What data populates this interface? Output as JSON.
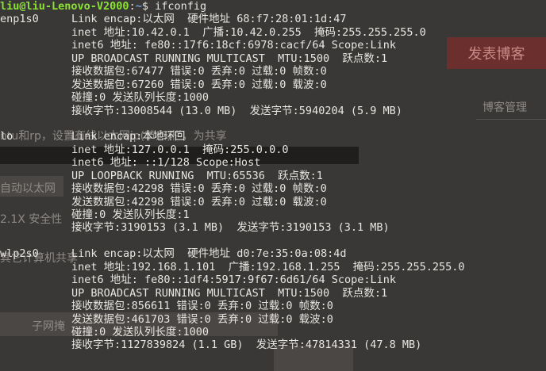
{
  "prompt": {
    "user_host": "liu@liu-Lenovo-V2000",
    "sep": ":",
    "path": "~",
    "symbol": "$ ",
    "command": "ifconfig"
  },
  "background": {
    "publish_button": "发表博客",
    "manage_link": "博客管理",
    "text_1": "ntu和rp，设置有线以太网ip(节点)栏，为共享",
    "text_2": "自动以太网",
    "text_3": "2.1X 安全性",
    "text_4": "其它计算机共享",
    "text_5": "子网掩"
  },
  "interfaces": [
    {
      "name": "enp1s0",
      "lines": [
        "Link encap:以太网  硬件地址 68:f7:28:01:1d:47",
        "inet 地址:10.42.0.1  广播:10.42.0.255  掩码:255.255.255.0",
        "inet6 地址: fe80::17f6:18cf:6978:cacf/64 Scope:Link",
        "UP BROADCAST RUNNING MULTICAST  MTU:1500  跃点数:1",
        "接收数据包:67477 错误:0 丢弃:0 过载:0 帧数:0",
        "发送数据包:67260 错误:0 丢弃:0 过载:0 载波:0",
        "碰撞:0 发送队列长度:1000",
        "接收字节:13008544 (13.0 MB)  发送字节:5940204 (5.9 MB)"
      ]
    },
    {
      "name": "lo",
      "lines": [
        "Link encap:本地环回",
        "inet 地址:127.0.0.1  掩码:255.0.0.0",
        "inet6 地址: ::1/128 Scope:Host",
        "UP LOOPBACK RUNNING  MTU:65536  跃点数:1",
        "接收数据包:42298 错误:0 丢弃:0 过载:0 帧数:0",
        "发送数据包:42298 错误:0 丢弃:0 过载:0 载波:0",
        "碰撞:0 发送队列长度:1",
        "接收字节:3190153 (3.1 MB)  发送字节:3190153 (3.1 MB)"
      ]
    },
    {
      "name": "wlp2s0",
      "lines": [
        "Link encap:以太网  硬件地址 d0:7e:35:0a:08:4d",
        "inet 地址:192.168.1.101  广播:192.168.1.255  掩码:255.255.255.0",
        "inet6 地址: fe80::1df4:5917:9f67:6d61/64 Scope:Link",
        "UP BROADCAST RUNNING MULTICAST  MTU:1500  跃点数:1",
        "接收数据包:856611 错误:0 丢弃:0 过载:0 帧数:0",
        "发送数据包:461703 错误:0 丢弃:0 过载:0 载波:0",
        "碰撞:0 发送队列长度:1000",
        "接收字节:1127839824 (1.1 GB)  发送字节:47814331 (47.8 MB)"
      ]
    }
  ],
  "colors": {
    "terminal_bg": "#2f2d2b",
    "prompt_user": "#8ae234",
    "prompt_path": "#729fcf",
    "text": "#e8e6e1",
    "publish_button_bg": "#6b2f2d"
  }
}
